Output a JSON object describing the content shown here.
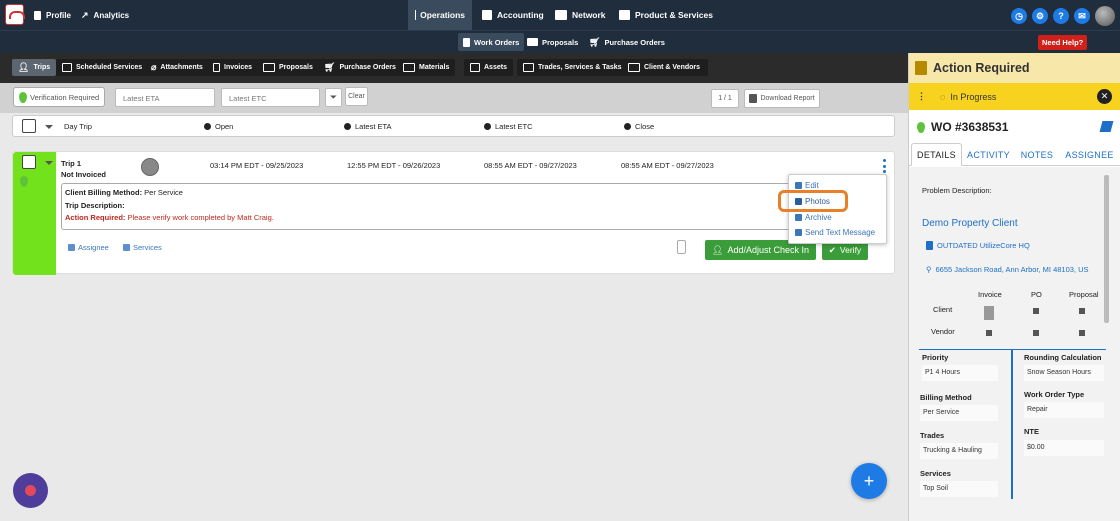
{
  "topnav": {
    "profile": "Profile",
    "analytics": "Analytics",
    "operations": "Operations",
    "accounting": "Accounting",
    "network": "Network",
    "products": "Product & Services"
  },
  "subnav": {
    "work_orders": "Work Orders",
    "proposals": "Proposals",
    "purchase_orders": "Purchase Orders",
    "need_help": "Need Help?"
  },
  "tabs": [
    "Trips",
    "Scheduled Services",
    "Attachments",
    "Invoices",
    "Proposals",
    "Purchase Orders",
    "Materials",
    "Assets",
    "Trades, Services & Tasks",
    "Client & Vendors"
  ],
  "filters": {
    "verification": "Verification Required",
    "latest_eta_placeholder": "Latest ETA",
    "latest_etc_placeholder": "Latest ETC",
    "clear": "Clear",
    "pagination": "1 / 1",
    "download": "Download Report"
  },
  "table": {
    "headers": [
      "Day Trip",
      "Open",
      "Latest ETA",
      "Latest ETC",
      "Close"
    ]
  },
  "trip": {
    "name": "Trip 1",
    "status": "Not Invoiced",
    "open": "03:14 PM EDT - 09/25/2023",
    "eta": "12:55 PM EDT - 09/26/2023",
    "etc": "08:55 AM EDT - 09/27/2023",
    "close": "08:55 AM EDT - 09/27/2023",
    "billing_label": "Client Billing Method:",
    "billing_value": "Per Service",
    "description_label": "Trip Description:",
    "action_label": "Action Required:",
    "action_value": "Please verify work completed by Matt Craig.",
    "assignee": "Assignee",
    "services": "Services",
    "add_checkin": "Add/Adjust Check In",
    "verify": "Verify"
  },
  "menu": {
    "edit": "Edit",
    "photos": "Photos",
    "archive": "Archive",
    "send_text": "Send Text Message"
  },
  "panel": {
    "title": "Action Required",
    "status": "In Progress",
    "wo_number": "WO #3638531",
    "tabs": [
      "DETAILS",
      "ACTIVITY",
      "NOTES",
      "ASSIGNEE"
    ],
    "problem_label": "Problem Description:",
    "client_name": "Demo Property Client",
    "location": "OUTDATED UtilizeCore HQ",
    "address": "6655 Jackson Road, Ann Arbor, MI 48103, US",
    "doc_cols": [
      "Invoice",
      "PO",
      "Proposal"
    ],
    "doc_rows": [
      "Client",
      "Vendor"
    ],
    "priority_label": "Priority",
    "priority": "P1 4 Hours",
    "rounding_label": "Rounding Calculation",
    "rounding": "Snow Season Hours",
    "billing_label": "Billing Method",
    "billing": "Per Service",
    "wo_type_label": "Work Order Type",
    "wo_type": "Repair",
    "trades_label": "Trades",
    "trades": "Trucking & Hauling",
    "nte_label": "NTE",
    "nte": "$0.00",
    "services_label": "Services",
    "services": "Top Soil"
  },
  "colors": {
    "nav_bg": "#1f2d3d",
    "accent_blue": "#1e7be6",
    "trip_green": "#72e21c",
    "action_yellow": "#f7d21e",
    "verify_green": "#3b9d3a",
    "highlight_orange": "#e8802a",
    "alert_red": "#d0201a"
  }
}
